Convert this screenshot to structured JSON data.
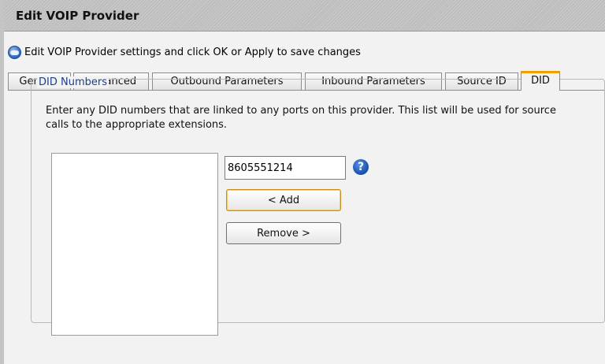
{
  "window": {
    "title": "Edit VOIP Provider"
  },
  "info": {
    "icon": "info-icon",
    "text": "Edit VOIP Provider settings and click OK or Apply to save changes"
  },
  "tabs": [
    {
      "label": "General",
      "active": false
    },
    {
      "label": "Advanced",
      "active": false
    },
    {
      "label": "Outbound Parameters",
      "active": false
    },
    {
      "label": "Inbound Parameters",
      "active": false
    },
    {
      "label": "Source ID",
      "active": false
    },
    {
      "label": "DID",
      "active": true
    }
  ],
  "did": {
    "legend": "DID Numbers",
    "description": "Enter any DID numbers that are linked to any ports on this provider. This list will be used for source\ncalls to the appropriate extensions.",
    "list_items": [],
    "input_value": "8605551214",
    "add_label": "< Add",
    "remove_label": "Remove >",
    "help_icon": "help-icon"
  },
  "colors": {
    "active_tab_accent": "#f0a000",
    "legend_text": "#1d3f8a",
    "help_icon": "#1d58b4"
  }
}
